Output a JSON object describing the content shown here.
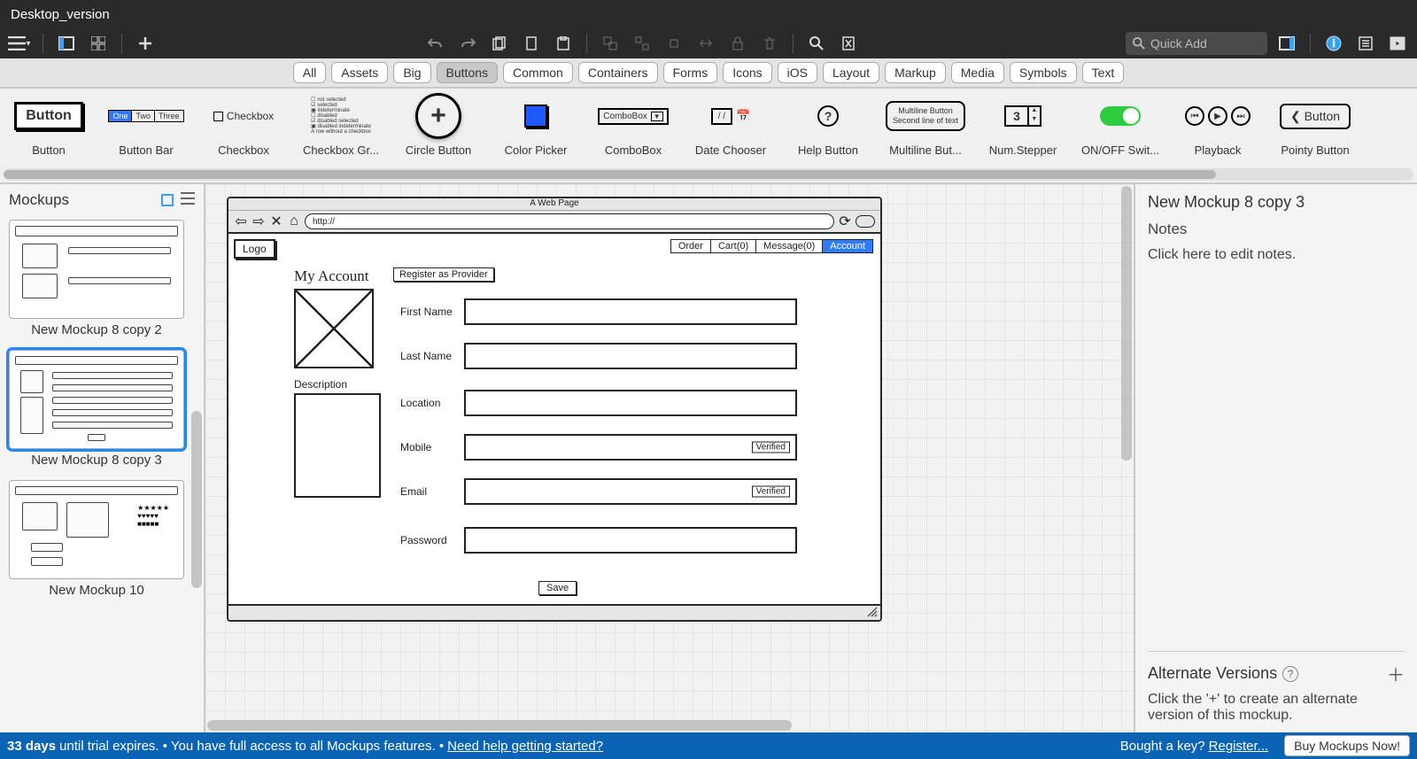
{
  "titlebar": {
    "project_name": "Desktop_version"
  },
  "toolbar": {
    "quick_add_placeholder": "Quick Add"
  },
  "categories": {
    "items": [
      "All",
      "Assets",
      "Big",
      "Buttons",
      "Common",
      "Containers",
      "Forms",
      "Icons",
      "iOS",
      "Layout",
      "Markup",
      "Media",
      "Symbols",
      "Text"
    ],
    "selected_index": 3
  },
  "library": {
    "items": [
      {
        "label": "Button",
        "preview_text": "Button"
      },
      {
        "label": "Button Bar",
        "preview_segments": [
          "One",
          "Two",
          "Three"
        ]
      },
      {
        "label": "Checkbox",
        "preview_text": "Checkbox"
      },
      {
        "label": "Checkbox Gr...",
        "preview_lines": [
          "not selected",
          "selected",
          "indeterminate",
          "disabled",
          "disabled selected",
          "disabled indeterminate",
          "A row without a checkbox"
        ]
      },
      {
        "label": "Circle Button",
        "preview_text": "+"
      },
      {
        "label": "Color Picker",
        "preview_color": "#1e58ff"
      },
      {
        "label": "ComboBox",
        "preview_text": "ComboBox"
      },
      {
        "label": "Date Chooser",
        "preview_text": "/  /"
      },
      {
        "label": "Help Button",
        "preview_text": "?"
      },
      {
        "label": "Multiline But...",
        "preview_primary": "Multiline Button",
        "preview_secondary": "Second line of text"
      },
      {
        "label": "Num.Stepper",
        "preview_text": "3"
      },
      {
        "label": "ON/OFF Swit..."
      },
      {
        "label": "Playback"
      },
      {
        "label": "Pointy Button",
        "preview_text": "Button"
      }
    ]
  },
  "left_panel": {
    "header": "Mockups",
    "items": [
      {
        "name": "New Mockup 8 copy 2"
      },
      {
        "name": "New Mockup 8 copy 3"
      },
      {
        "name": "New Mockup 10"
      }
    ],
    "selected_index": 1
  },
  "canvas": {
    "browser_title": "A Web Page",
    "url_value": "http://",
    "logo_text": "Logo",
    "nav_items": [
      "Order",
      "Cart(0)",
      "Message(0)",
      "Account"
    ],
    "nav_active_index": 3,
    "page_heading": "My Account",
    "register_button": "Register as Provider",
    "description_label": "Description",
    "fields": [
      {
        "label": "First Name",
        "verified": false
      },
      {
        "label": "Last Name",
        "verified": false
      },
      {
        "label": "Location",
        "verified": false
      },
      {
        "label": "Mobile",
        "verified": true
      },
      {
        "label": "Email",
        "verified": true
      },
      {
        "label": "Password",
        "verified": false
      }
    ],
    "verified_badge": "Verified",
    "save_button": "Save"
  },
  "inspector": {
    "title": "New Mockup 8 copy 3",
    "notes_header": "Notes",
    "notes_placeholder": "Click here to edit notes.",
    "alt_header": "Alternate Versions",
    "alt_message": "Click the '+' to create an alternate version of this mockup."
  },
  "status": {
    "days": "33 days",
    "trial_text": " until trial expires. • You have full access to all Mockups features. • ",
    "help_link": "Need help getting started?",
    "bought_text": "Bought a key? ",
    "register_link": "Register...",
    "buy_button": "Buy Mockups Now!"
  }
}
